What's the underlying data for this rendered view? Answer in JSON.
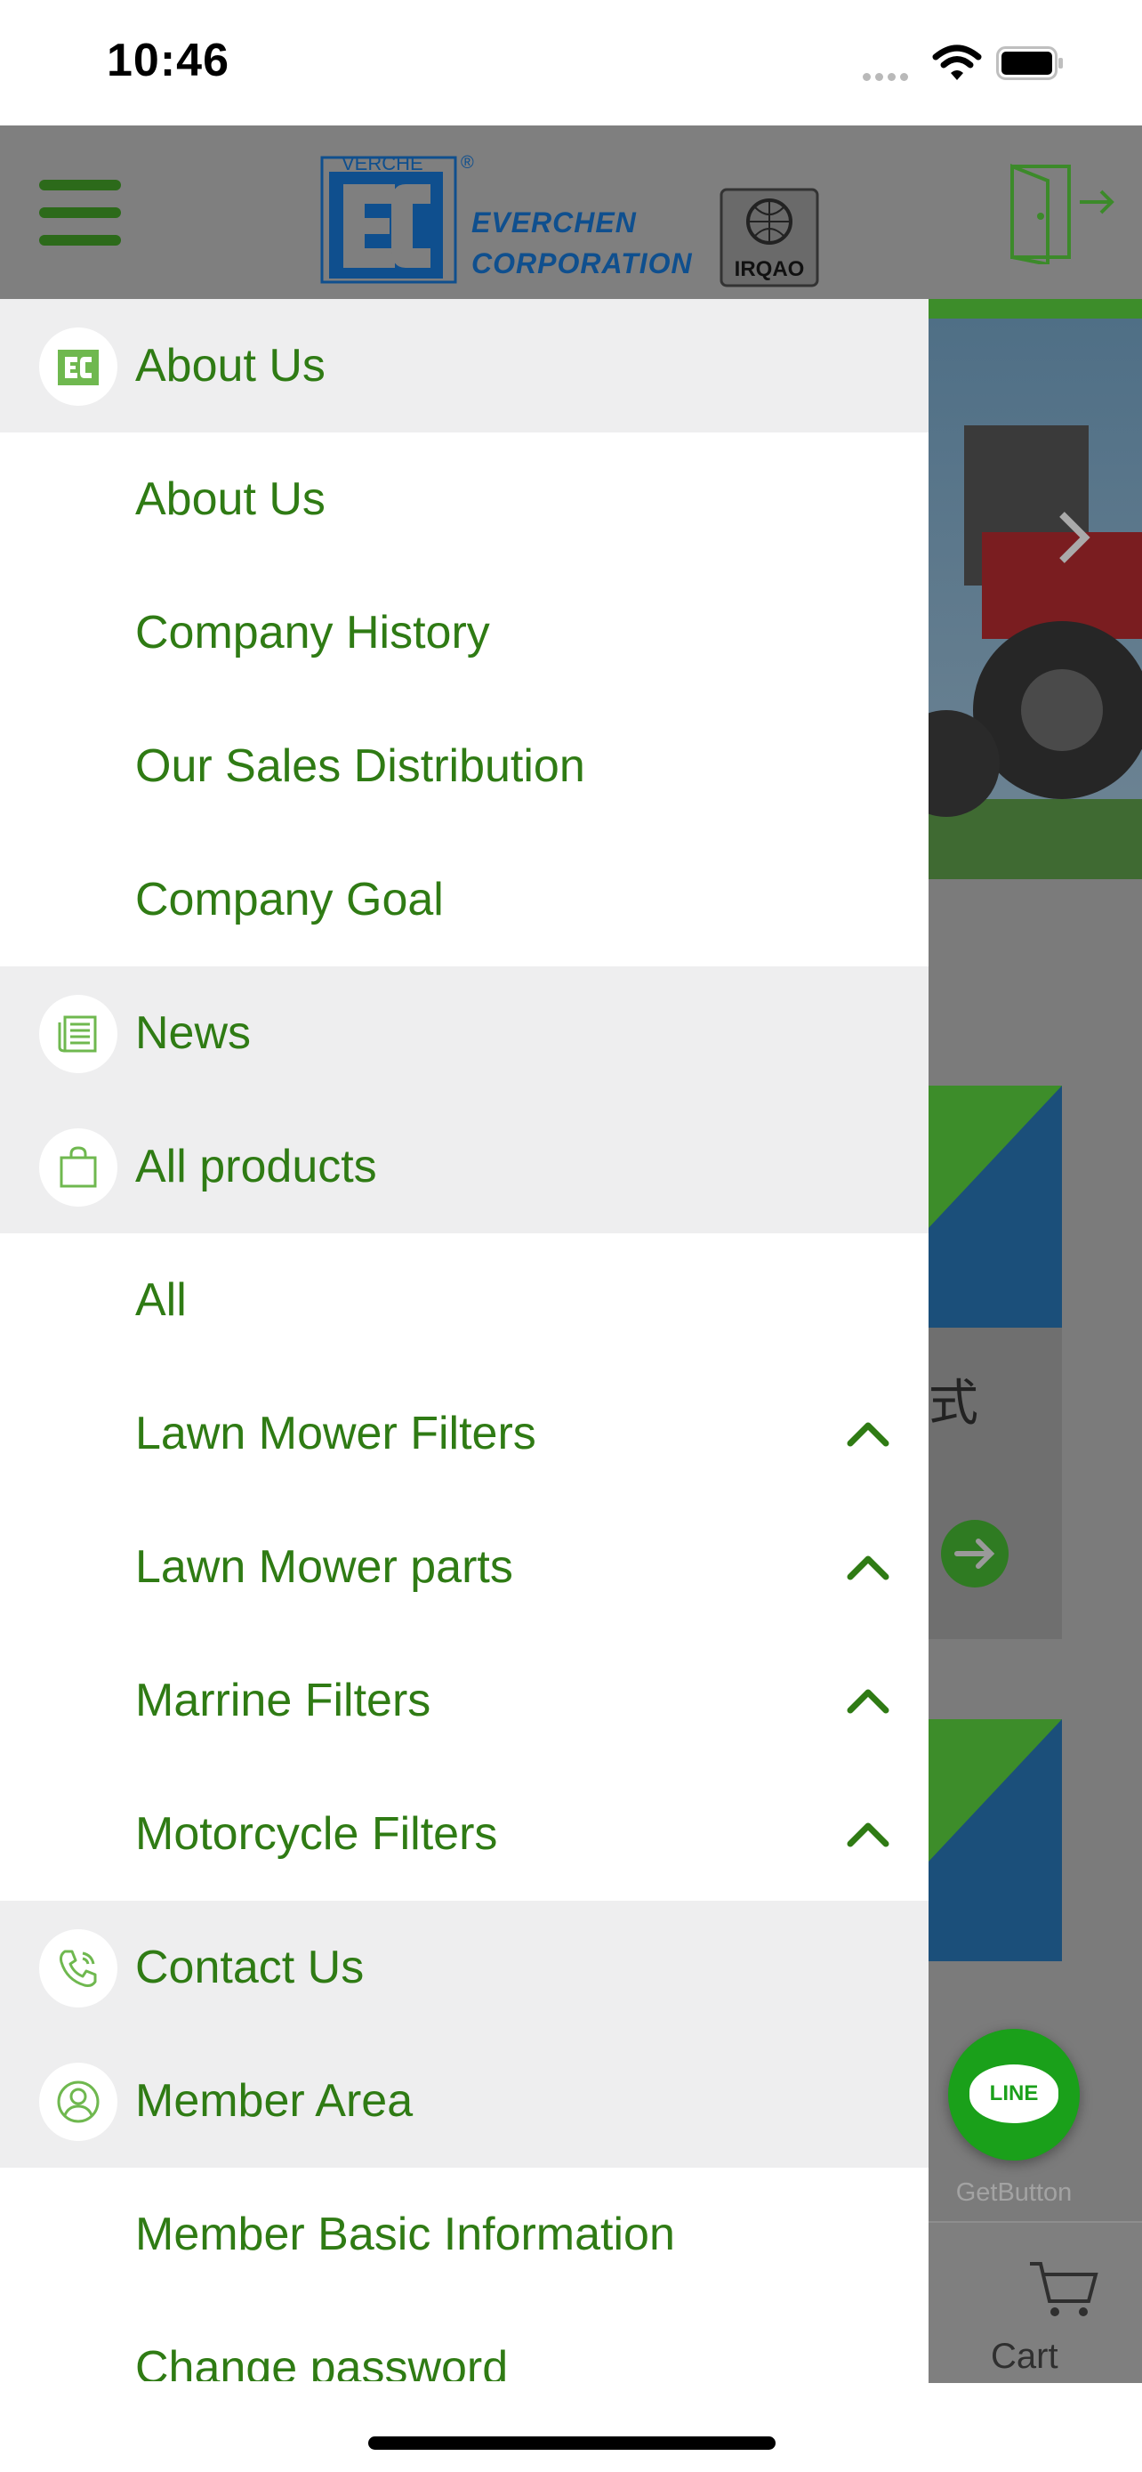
{
  "status_bar": {
    "time": "10:46"
  },
  "header": {
    "logo": {
      "mark_text": "VERCHE",
      "company_line1": "EVERCHEN",
      "company_line2": "CORPORATION",
      "cert_text": "IRQAO"
    }
  },
  "drawer": {
    "rows": [
      {
        "label": "About Us",
        "section": true,
        "icon": "about-us-logo-icon"
      },
      {
        "label": "About Us",
        "section": false
      },
      {
        "label": "Company History",
        "section": false
      },
      {
        "label": "Our Sales Distribution",
        "section": false
      },
      {
        "label": "Company Goal",
        "section": false
      },
      {
        "label": "News",
        "section": true,
        "icon": "news-icon"
      },
      {
        "label": "All products",
        "section": true,
        "icon": "shopping-bag-icon"
      },
      {
        "label": "All",
        "section": false
      },
      {
        "label": "Lawn Mower Filters",
        "section": false,
        "chevron": "chevron-up-icon"
      },
      {
        "label": "Lawn Mower parts",
        "section": false,
        "chevron": "chevron-up-icon"
      },
      {
        "label": "Marrine Filters",
        "section": false,
        "chevron": "chevron-up-icon"
      },
      {
        "label": "Motorcycle Filters",
        "section": false,
        "chevron": "chevron-up-icon"
      },
      {
        "label": "Contact Us",
        "section": true,
        "icon": "phone-icon"
      },
      {
        "label": "Member Area",
        "section": true,
        "icon": "user-icon"
      },
      {
        "label": "Member Basic Information",
        "section": false
      },
      {
        "label": "Change password",
        "section": false
      }
    ]
  },
  "background": {
    "card_text": "式",
    "line_button_label": "LINE",
    "getbutton_label": "GetButton",
    "tabbar": {
      "cart_label": "Cart"
    }
  },
  "colors": {
    "accent_green": "#2f7b14",
    "section_bg": "#eeeeef",
    "overlay_gray": "#7f7f7f",
    "logo_blue": "#0f4f8e"
  }
}
